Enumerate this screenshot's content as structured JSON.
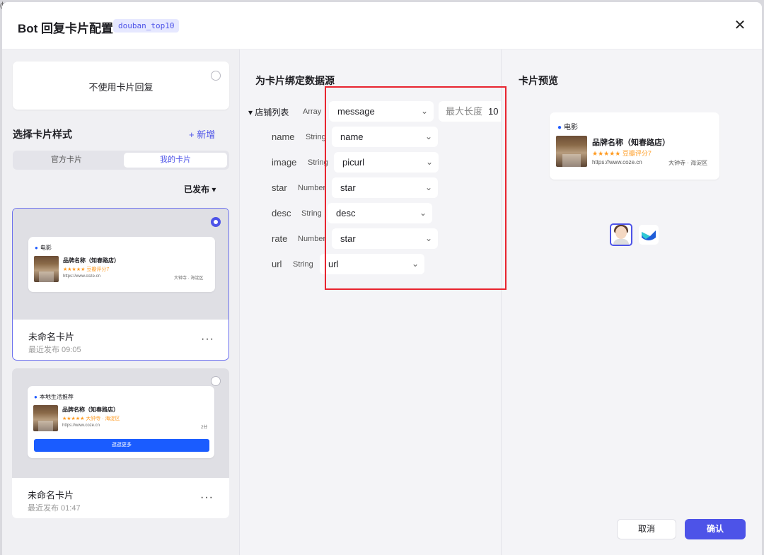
{
  "backdrop": {
    "glyph": "ტ"
  },
  "header": {
    "title": "Bot 回复卡片配置",
    "tag": "douban_top10",
    "close_glyph": "✕"
  },
  "left": {
    "no_card_label": "不使用卡片回复",
    "section_title": "选择卡片样式",
    "new_button": "+ 新增",
    "tabs": [
      {
        "label": "官方卡片"
      },
      {
        "label": "我的卡片"
      }
    ],
    "filter": "已发布 ▾",
    "cards": [
      {
        "location": "电影",
        "name": "品牌名称（知春路店）",
        "stars": "★★★★★ 豆瓣评分7",
        "url": "https://www.coze.cn",
        "addr": "大钟寺 · 海淀区",
        "title": "未命名卡片",
        "sub": "最近发布 09:05"
      },
      {
        "location": "本地生活推荐",
        "name": "品牌名称（知春路店）",
        "stars": "★★★★★ 大钟寺 · 海淀区",
        "url": "https://www.coze.cn",
        "addr": "2分",
        "cta": "逛逛更多",
        "title": "未命名卡片",
        "sub": "最近发布 01:47"
      }
    ],
    "more_glyph": "···"
  },
  "middle": {
    "title": "为卡片绑定数据源",
    "list_label": "▾ 店铺列表",
    "list_type": "Array",
    "list_value": "message",
    "maxlen_label": "最大长度",
    "maxlen_value": "10",
    "fields": [
      {
        "label": "name",
        "type": "String",
        "value": "name"
      },
      {
        "label": "image",
        "type": "String",
        "value": "picurl"
      },
      {
        "label": "star",
        "type": "Number",
        "value": "star"
      },
      {
        "label": "desc",
        "type": "String",
        "value": "desc"
      },
      {
        "label": "rate",
        "type": "Number",
        "value": "star"
      },
      {
        "label": "url",
        "type": "String",
        "value": "url"
      }
    ],
    "chevron": "⌄"
  },
  "right": {
    "title": "卡片预览",
    "card": {
      "location": "电影",
      "name": "品牌名称（知春路店）",
      "stars": "★★★★★ 豆瓣评分7",
      "url": "https://www.coze.cn",
      "addr": "大钟寺 · 海淀区"
    }
  },
  "footer": {
    "cancel": "取消",
    "confirm": "确认"
  },
  "colors": {
    "accent": "#4d53e8",
    "highlight": "#e8242f",
    "cta": "#1a5cff",
    "stars": "#ff9a1f"
  }
}
